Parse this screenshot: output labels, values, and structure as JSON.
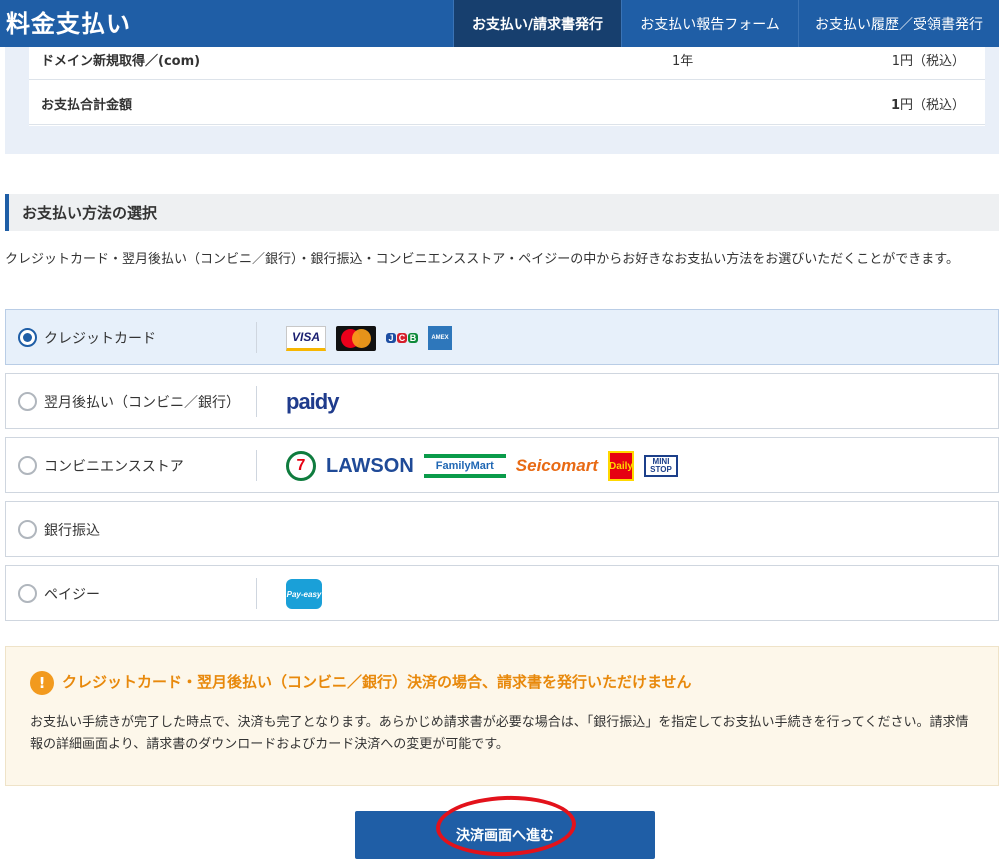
{
  "header": {
    "title": "料金支払い",
    "tabs": [
      {
        "label": "お支払い/請求書発行",
        "active": true
      },
      {
        "label": "お支払い報告フォーム",
        "active": false
      },
      {
        "label": "お支払い履歴／受領書発行",
        "active": false
      }
    ]
  },
  "summary": {
    "item": {
      "name": "ドメイン新規取得／(com)",
      "term": "1年",
      "amount": "1円（税込）"
    },
    "total": {
      "label": "お支払合計金額",
      "amount_value": "1",
      "amount_suffix": "円（税込）"
    }
  },
  "payment_section": {
    "title": "お支払い方法の選択",
    "description": "クレジットカード・翌月後払い（コンビニ／銀行）・銀行振込・コンビニエンスストア・ペイジーの中からお好きなお支払い方法をお選びいただくことができます。",
    "options": [
      {
        "label": "クレジットカード",
        "selected": true,
        "logos": [
          "VISA",
          "Mastercard",
          "JCB",
          "AMERICAN EXPRESS"
        ]
      },
      {
        "label": "翌月後払い（コンビニ／銀行）",
        "selected": false,
        "logos": [
          "paidy"
        ]
      },
      {
        "label": "コンビニエンスストア",
        "selected": false,
        "logos": [
          "7",
          "LAWSON",
          "FamilyMart",
          "Seicomart",
          "Daily",
          "MINI STOP"
        ]
      },
      {
        "label": "銀行振込",
        "selected": false,
        "logos": []
      },
      {
        "label": "ペイジー",
        "selected": false,
        "logos": [
          "Pay-easy"
        ]
      }
    ]
  },
  "notice": {
    "title": "クレジットカード・翌月後払い（コンビニ／銀行）決済の場合、請求書を発行いただけません",
    "body": "お支払い手続きが完了した時点で、決済も完了となります。あらかじめ請求書が必要な場合は、「銀行振込」を指定してお支払い手続きを行ってください。請求情報の詳細画面より、請求書のダウンロードおよびカード決済への変更が可能です。",
    "icon": "!"
  },
  "proceed_button": {
    "label": "決済画面へ進む"
  },
  "colors": {
    "primary": "#1f5ea6",
    "primary_dark": "#173f6e",
    "warning": "#e8890c",
    "annotation": "#e3121b"
  }
}
